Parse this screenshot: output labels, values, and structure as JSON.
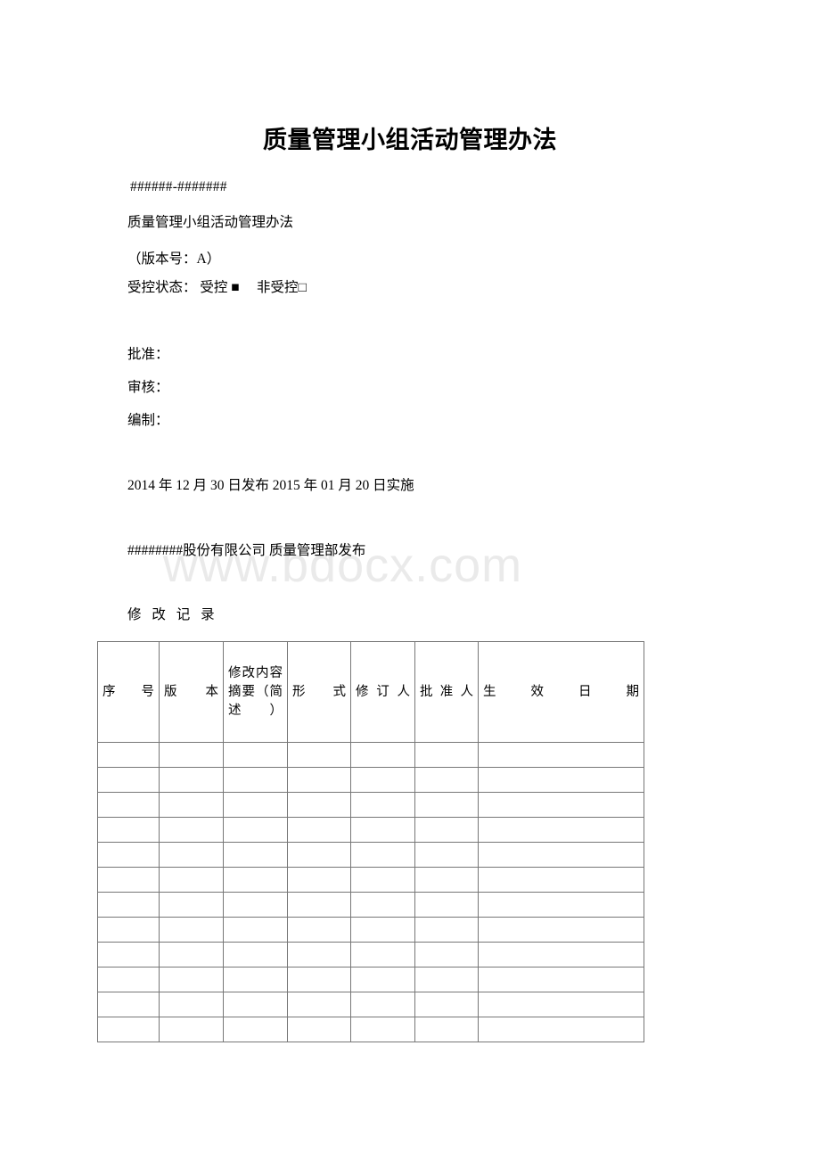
{
  "document": {
    "title": "质量管理小组活动管理办法",
    "watermark": "www.bdocx.com",
    "cover": {
      "doc_number": "######-#######",
      "doc_name": "质量管理小组活动管理办法",
      "version": "（版本号：A）",
      "control_status": "受控状态： 受控 ■　 非受控□",
      "approve_label": "批准：",
      "review_label": "审核：",
      "prepare_label": "编制：",
      "issue_effective": "2014 年 12 月 30 日发布 2015 年 01 月 20 日实施",
      "publisher": "########股份有限公司 质量管理部发布"
    },
    "revision": {
      "heading": "修 改 记 录",
      "columns": [
        "序号",
        "版本",
        "修改内容摘要（简述）",
        "形式",
        "修订人",
        "批准人",
        "生效日期"
      ],
      "rows": [
        [
          "",
          "",
          "",
          "",
          "",
          "",
          ""
        ],
        [
          "",
          "",
          "",
          "",
          "",
          "",
          ""
        ],
        [
          "",
          "",
          "",
          "",
          "",
          "",
          ""
        ],
        [
          "",
          "",
          "",
          "",
          "",
          "",
          ""
        ],
        [
          "",
          "",
          "",
          "",
          "",
          "",
          ""
        ],
        [
          "",
          "",
          "",
          "",
          "",
          "",
          ""
        ],
        [
          "",
          "",
          "",
          "",
          "",
          "",
          ""
        ],
        [
          "",
          "",
          "",
          "",
          "",
          "",
          ""
        ],
        [
          "",
          "",
          "",
          "",
          "",
          "",
          ""
        ],
        [
          "",
          "",
          "",
          "",
          "",
          "",
          ""
        ],
        [
          "",
          "",
          "",
          "",
          "",
          "",
          ""
        ],
        [
          "",
          "",
          "",
          "",
          "",
          "",
          ""
        ]
      ]
    }
  }
}
